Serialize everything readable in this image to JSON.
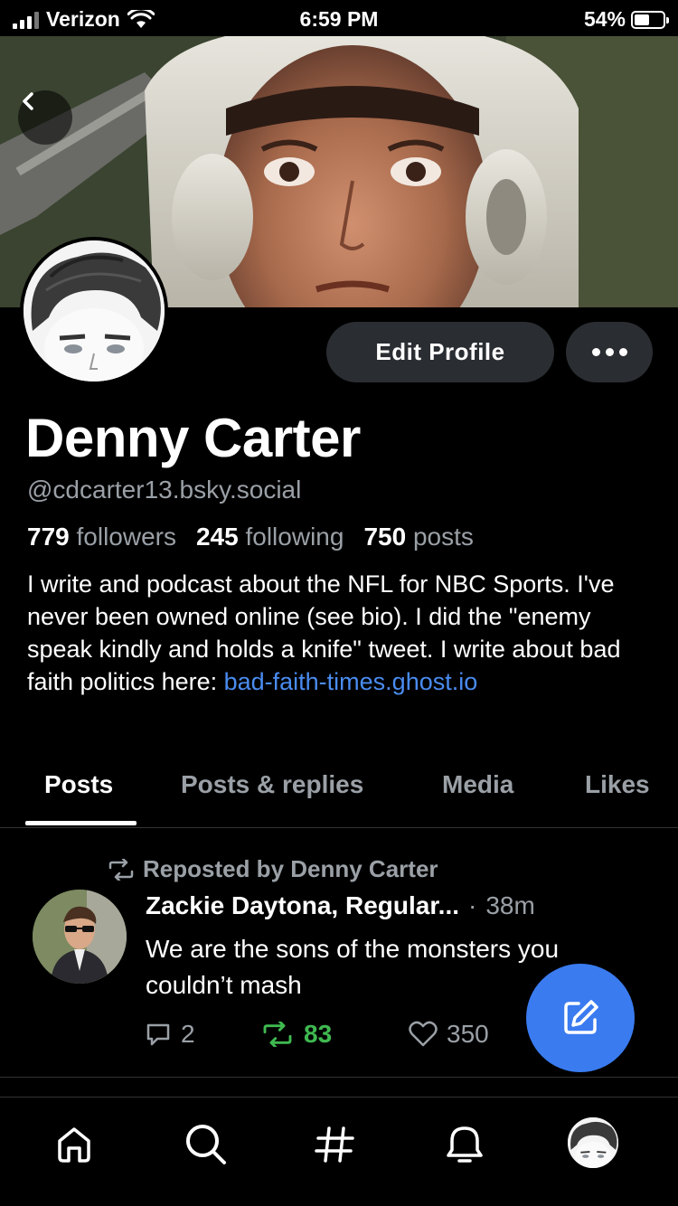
{
  "status_bar": {
    "carrier": "Verizon",
    "time": "6:59 PM",
    "battery": "54%",
    "battery_level": 0.54
  },
  "profile": {
    "display_name": "Denny Carter",
    "handle": "@cdcarter13.bsky.social",
    "followers_count": "779",
    "followers_label": "followers",
    "following_count": "245",
    "following_label": "following",
    "posts_count": "750",
    "posts_label": "posts",
    "bio_text": "I write and podcast about the NFL for NBC Sports. I've never been owned online (see bio). I did the \"enemy speak kindly and holds a knife\" tweet. I write about bad faith politics here: ",
    "bio_link": "bad-faith-times.ghost.io",
    "edit_label": "Edit Profile"
  },
  "tabs": [
    {
      "label": "Posts",
      "active": true
    },
    {
      "label": "Posts & replies",
      "active": false
    },
    {
      "label": "Media",
      "active": false
    },
    {
      "label": "Likes",
      "active": false
    }
  ],
  "post": {
    "repost_label": "Reposted by Denny Carter",
    "author": "Zackie Daytona, Regular...",
    "separator": "·",
    "time": "38m",
    "text": "We are the sons of the monsters you couldn’t mash",
    "replies": "2",
    "reposts": "83",
    "likes": "350"
  },
  "colors": {
    "accent": "#3a7bf0",
    "link": "#4a8cf0",
    "repost_green": "#3fb950",
    "muted": "#9aa0a6"
  },
  "icons": {
    "back": "chevron-left-icon",
    "more": "ellipsis-icon",
    "repost": "repost-icon",
    "reply": "comment-icon",
    "like": "heart-icon",
    "compose": "compose-icon",
    "nav": [
      "home-icon",
      "search-icon",
      "hashtag-icon",
      "notifications-icon",
      "profile-avatar"
    ]
  }
}
